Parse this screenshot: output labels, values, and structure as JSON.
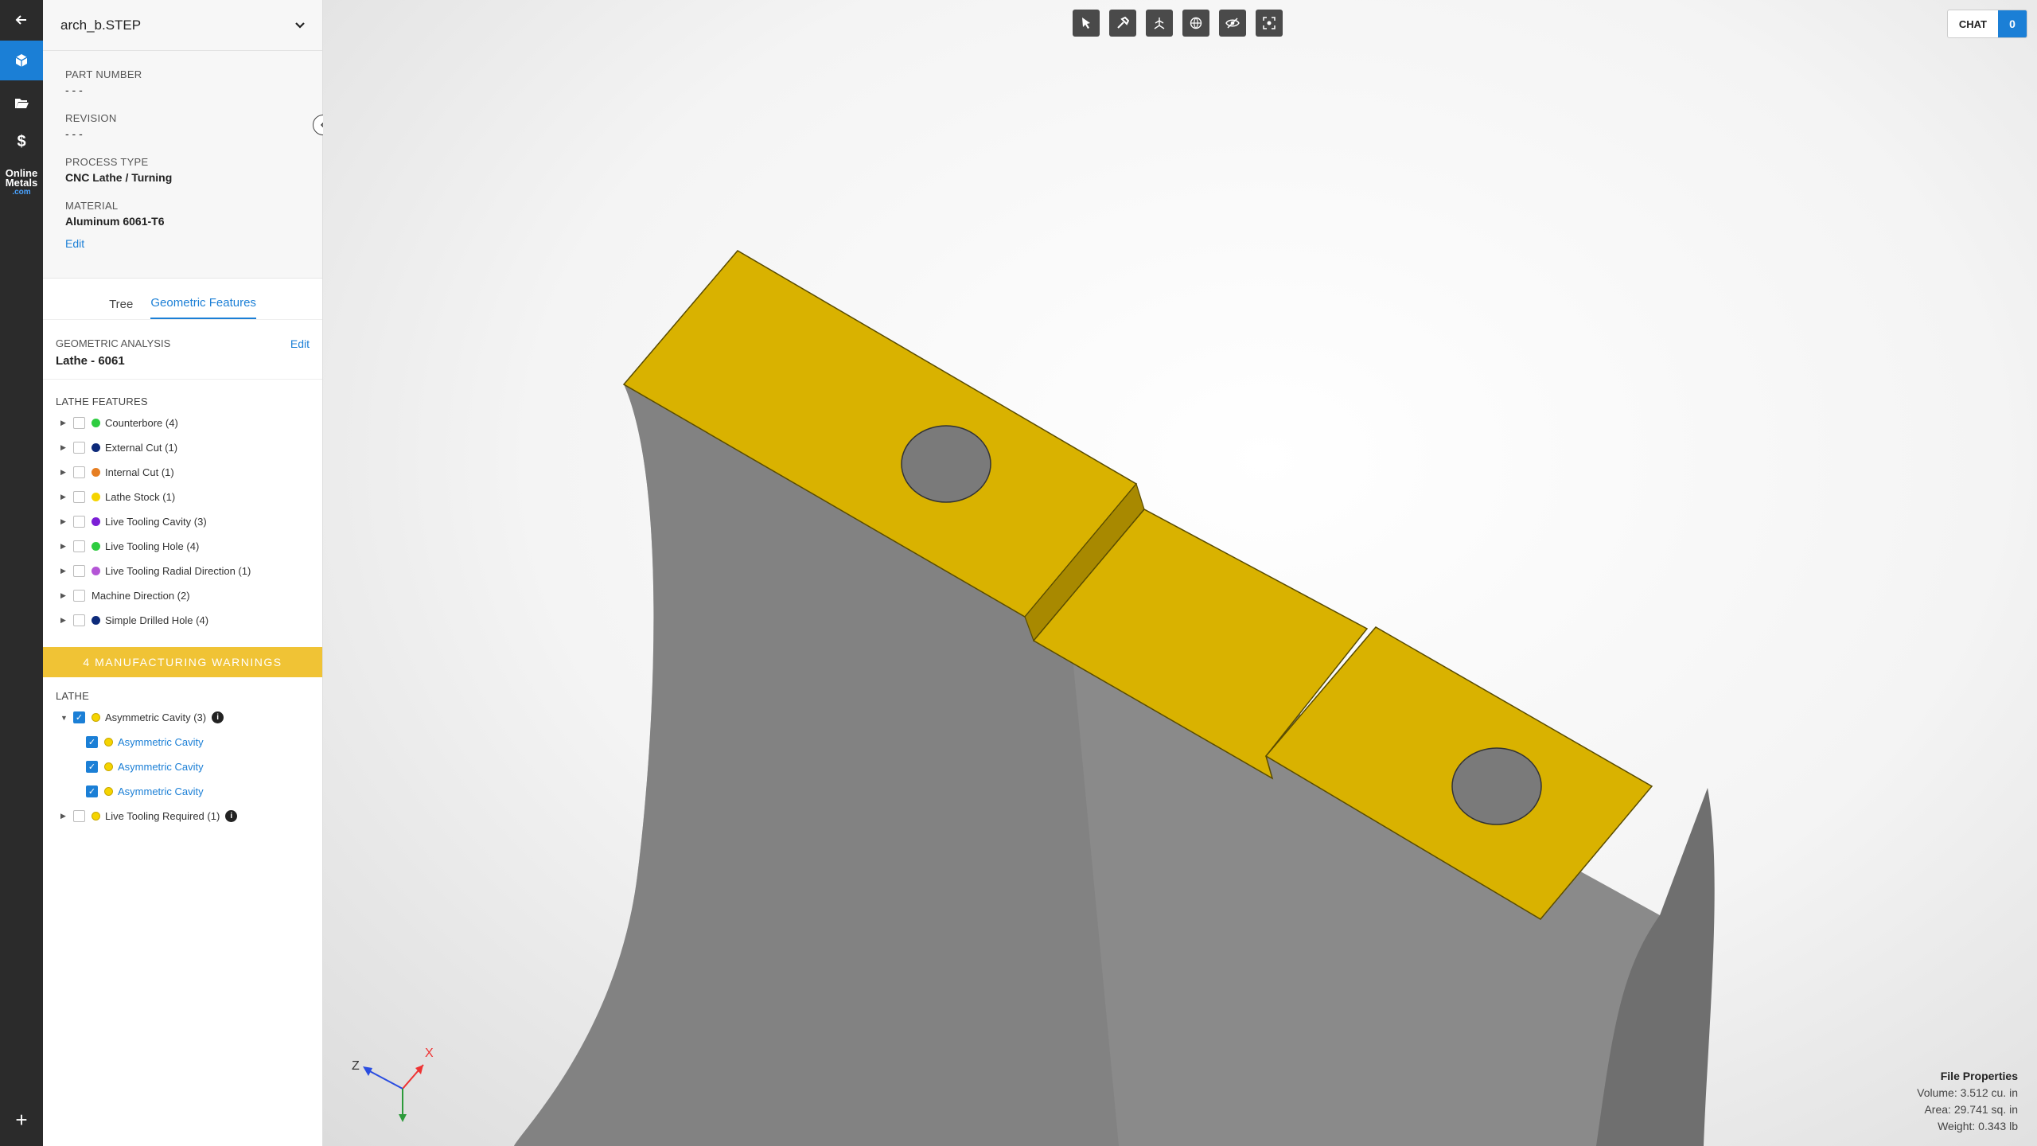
{
  "file": {
    "name": "arch_b.STEP"
  },
  "rail": {
    "logo_line1": "Online",
    "logo_line2": "Metals",
    "logo_line3": ".com"
  },
  "properties": {
    "part_number_label": "PART NUMBER",
    "part_number_value": "- - -",
    "revision_label": "REVISION",
    "revision_value": "- - -",
    "process_type_label": "PROCESS TYPE",
    "process_type_value": "CNC Lathe / Turning",
    "material_label": "MATERIAL",
    "material_value": "Aluminum 6061-T6",
    "edit_label": "Edit"
  },
  "tabs": [
    {
      "label": "Tree",
      "active": false
    },
    {
      "label": "Geometric Features",
      "active": true
    }
  ],
  "geometric_analysis": {
    "label": "GEOMETRIC ANALYSIS",
    "value": "Lathe - 6061",
    "edit_label": "Edit"
  },
  "lathe_features": {
    "title": "LATHE FEATURES",
    "items": [
      {
        "label": "Counterbore (4)",
        "color": "#2ecc40"
      },
      {
        "label": "External Cut (1)",
        "color": "#0d2a7a"
      },
      {
        "label": "Internal Cut (1)",
        "color": "#e67e22"
      },
      {
        "label": "Lathe Stock (1)",
        "color": "#f5d400"
      },
      {
        "label": "Live Tooling Cavity (3)",
        "color": "#7b1fd6"
      },
      {
        "label": "Live Tooling Hole (4)",
        "color": "#2ecc40"
      },
      {
        "label": "Live Tooling Radial Direction (1)",
        "color": "#b455d6"
      },
      {
        "label": "Machine Direction (2)",
        "color": ""
      },
      {
        "label": "Simple Drilled Hole (4)",
        "color": "#0d2a7a"
      }
    ]
  },
  "warnings": {
    "banner": "4 MANUFACTURING WARNINGS",
    "section": "LATHE",
    "group1": {
      "label": "Asymmetric Cavity (3)",
      "color": "#f5d400"
    },
    "children": [
      "Asymmetric Cavity",
      "Asymmetric Cavity",
      "Asymmetric Cavity"
    ],
    "group2": {
      "label": "Live Tooling Required (1)",
      "color": "#f5d400"
    }
  },
  "chat": {
    "label": "CHAT",
    "count": "0"
  },
  "axes": {
    "x": "X",
    "z": "Z"
  },
  "file_properties": {
    "title": "File Properties",
    "volume": "Volume: 3.512 cu. in",
    "area": "Area: 29.741 sq. in",
    "weight": "Weight: 0.343 lb"
  },
  "colors": {
    "accent": "#1b7fd6",
    "model_yellow": "#d9b200",
    "model_gray": "#8a8a8a",
    "warning": "#f0c335"
  },
  "toolbar_icons": [
    "select-icon",
    "hammer-icon",
    "explode-icon",
    "globe-icon",
    "hide-icon",
    "fit-view-icon"
  ]
}
